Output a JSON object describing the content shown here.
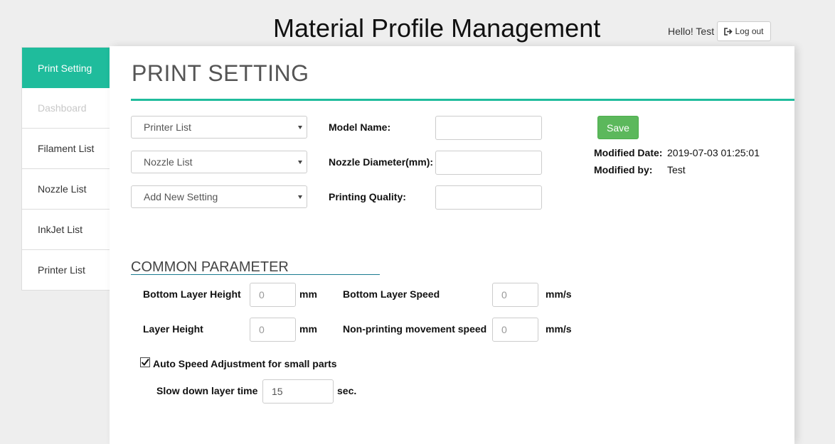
{
  "header": {
    "app_title": "Material Profile Management",
    "greeting": "Hello! Test",
    "logout_label": "Log out"
  },
  "sidebar": {
    "items": [
      {
        "label": "Print Setting",
        "state": "active"
      },
      {
        "label": "Dashboard",
        "state": "disabled"
      },
      {
        "label": "Filament List",
        "state": "normal"
      },
      {
        "label": "Nozzle List",
        "state": "normal"
      },
      {
        "label": "InkJet List",
        "state": "normal"
      },
      {
        "label": "Printer List",
        "state": "normal"
      }
    ]
  },
  "main": {
    "title": "PRINT SETTING",
    "selects": {
      "printer": "Printer List",
      "nozzle": "Nozzle List",
      "setting": "Add New Setting"
    },
    "fields": {
      "model_name_label": "Model Name:",
      "model_name_value": "",
      "nozzle_diameter_label": "Nozzle Diameter(mm):",
      "nozzle_diameter_value": "",
      "printing_quality_label": "Printing Quality:",
      "printing_quality_value": ""
    },
    "save_label": "Save",
    "modified_date_label": "Modified Date:",
    "modified_date_value": "2019-07-03 01:25:01",
    "modified_by_label": "Modified by:",
    "modified_by_value": "Test"
  },
  "common": {
    "title": "COMMON PARAMETER",
    "bottom_layer_height_label": "Bottom Layer Height",
    "bottom_layer_height_placeholder": "0",
    "bottom_layer_height_unit": "mm",
    "bottom_layer_speed_label": "Bottom Layer Speed",
    "bottom_layer_speed_placeholder": "0",
    "bottom_layer_speed_unit": "mm/s",
    "layer_height_label": "Layer Height",
    "layer_height_placeholder": "0",
    "layer_height_unit": "mm",
    "non_printing_speed_label": "Non-printing movement speed",
    "non_printing_speed_placeholder": "0",
    "non_printing_speed_unit": "mm/s",
    "auto_speed_label": "Auto Speed Adjustment for small parts",
    "auto_speed_checked": true,
    "slow_down_label": "Slow down layer time",
    "slow_down_value": "15",
    "slow_down_unit": "sec."
  },
  "colors": {
    "accent": "#1fbc9c",
    "save": "#5cb85c",
    "section_rule": "#1a7a90"
  }
}
